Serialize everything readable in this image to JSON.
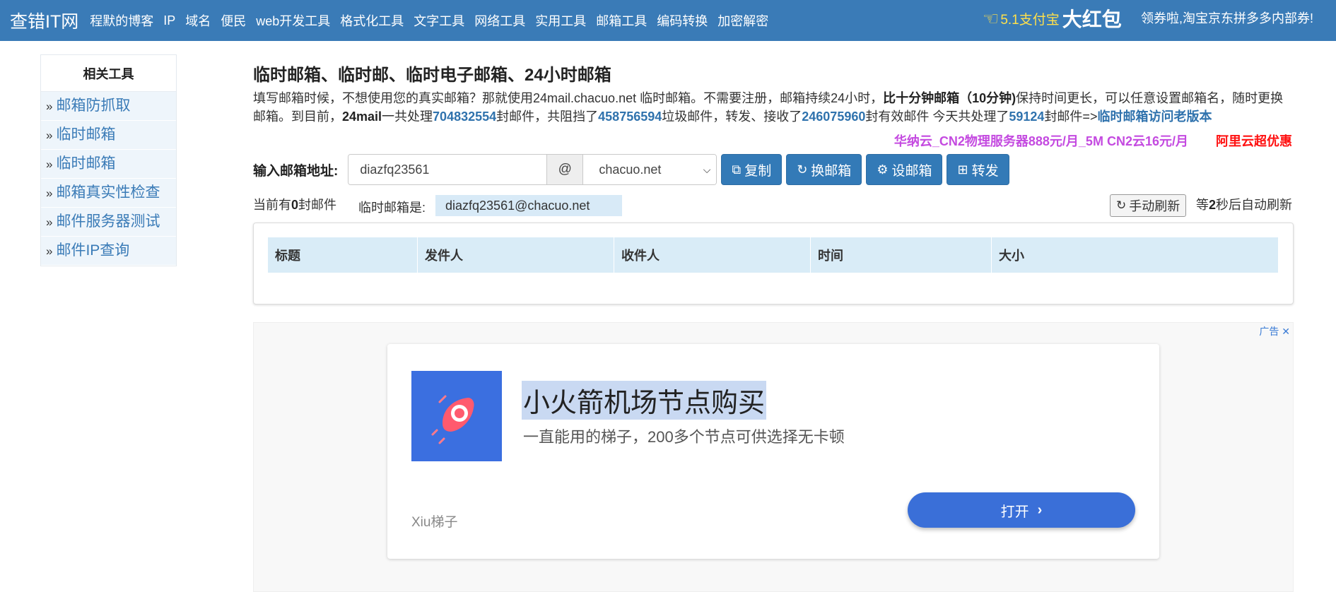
{
  "nav": {
    "brand": "查错IT网",
    "links": [
      "程默的博客",
      "IP",
      "域名",
      "便民",
      "web开发工具",
      "格式化工具",
      "文字工具",
      "网络工具",
      "实用工具",
      "邮箱工具",
      "编码转换",
      "加密解密"
    ],
    "promo_prefix": "5.1支付宝",
    "promo_big": "大红包",
    "coupon": "领券啦,淘宝京东拼多多内部券!"
  },
  "sidebar": {
    "title": "相关工具",
    "items": [
      "邮箱防抓取",
      "临时邮箱",
      "临时邮箱",
      "邮箱真实性检查",
      "邮件服务器测试",
      "邮件IP查询"
    ]
  },
  "main": {
    "title": "临时邮箱、临时邮、临时电子邮箱、24小时邮箱",
    "intro": {
      "p1": "填写邮箱时候，不想使用您的真实邮箱？那就使用24mail.chacuo.net 临时邮箱。不需要注册，邮箱持续24小时，",
      "bold1": "比十分钟邮箱（10分钟)",
      "p2": "保持时间更长，可以任意设置邮箱名，随时更换邮箱。到目前，",
      "bold2": "24mail",
      "p3": "一共处理",
      "n1": "704832554",
      "p4": "封邮件，共阻挡了",
      "n2": "458756594",
      "p5": "垃圾邮件，转发、接收了",
      "n3": "246075960",
      "p6": "封有效邮件 今天共处理了",
      "n4": "59124",
      "p7": "封邮件=>",
      "old_link": "临时邮箱访问老版本"
    },
    "ads": {
      "huana": "华纳云_CN2物理服务器888元/月_5M CN2云16元/月",
      "aliyun": "阿里云超优惠"
    },
    "address": {
      "label": "输入邮箱地址:",
      "value": "diazfq23561",
      "at": "@",
      "domain": "chacuo.net",
      "buttons": {
        "copy": "复制",
        "change": "换邮箱",
        "set": "设邮箱",
        "forward": "转发"
      }
    },
    "status": {
      "prefix": "当前有",
      "count": "0",
      "suffix": "封邮件",
      "mailbox_label": "临时邮箱是:",
      "mailbox_value": "diazfq23561@chacuo.net",
      "refresh": "手动刷新",
      "auto_prefix": "等",
      "auto_seconds": "2",
      "auto_suffix": "秒后自动刷新"
    },
    "table": {
      "headers": [
        "标题",
        "发件人",
        "收件人",
        "时间",
        "大小"
      ]
    }
  },
  "ad": {
    "badge": "广告",
    "title": "小火箭机场节点购买",
    "desc": "一直能用的梯子，200多个节点可供选择无卡顿",
    "brand": "Xiu梯子",
    "open": "打开"
  },
  "colors": {
    "nav_bg": "#3a7bb7",
    "primary": "#337ab7",
    "link": "#2f72ad",
    "ad_button": "#3a6fd8"
  }
}
